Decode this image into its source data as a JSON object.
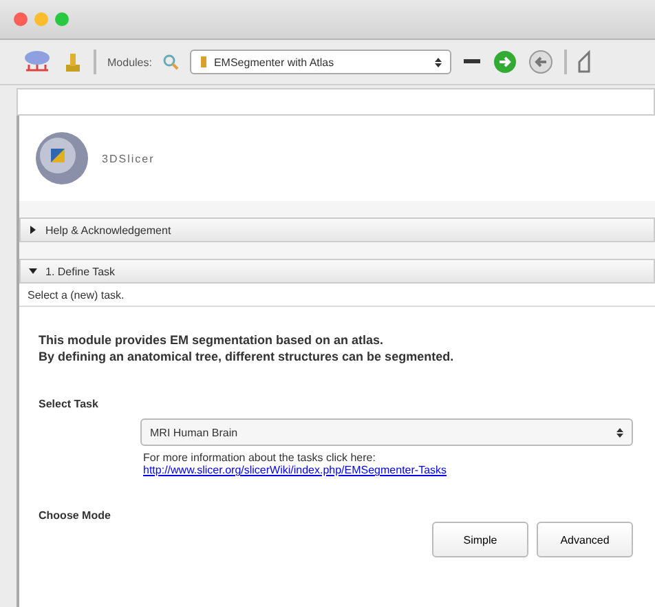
{
  "toolbar": {
    "modules_label": "Modules:",
    "module_select": "EMSegmenter with Atlas"
  },
  "logo": {
    "title": "3DSlicer"
  },
  "sections": [
    {
      "title": "Help & Acknowledgement",
      "expanded": false
    },
    {
      "title": "1. Define Task",
      "expanded": true
    }
  ],
  "define_task": {
    "subtitle": "Select a (new) task.",
    "description": [
      "This module provides EM segmentation based on an atlas.",
      "By defining an anatomical tree, different structures can be segmented."
    ],
    "select_task_label": "Select Task",
    "task_select": "MRI Human Brain",
    "info_text": "For more information about the tasks click here:",
    "info_link": "http://www.slicer.org/slicerWiki/index.php/EMSegmenter-Tasks",
    "choose_mode_label": "Choose Mode",
    "mode_buttons": [
      "Simple",
      "Advanced"
    ]
  }
}
